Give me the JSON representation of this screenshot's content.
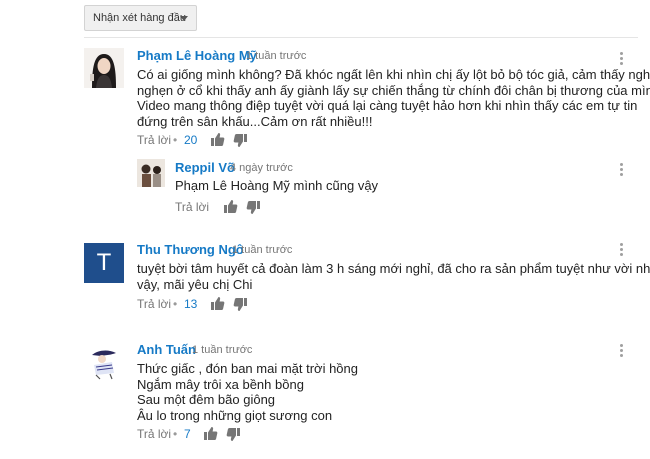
{
  "sort": {
    "label": "Nhận xét hàng đầu"
  },
  "comments": [
    {
      "author": "Phạm Lê Hoàng Mỹ",
      "time": "1 tuần trước",
      "lines": [
        "Có ai giống mình không? Đã khóc ngất lên khi nhìn chị ấy lột bỏ bộ tóc giả, cảm thấy nghèn",
        "nghẹn ở cổ khi thấy anh ấy giành lấy sự chiến thắng từ chính đôi chân bị thương của mình.",
        "Video mang thông điệp tuyệt vời quá lại càng tuyệt hảo hơn khi nhìn thấy các em tự tin",
        "đứng trên sân khấu...Cảm ơn rất nhiều!!!"
      ],
      "reply_label": "Trả lời",
      "likes": "20"
    },
    {
      "author": "Reppil Võ",
      "time": "4 ngày trước",
      "lines": [
        "Phạm Lê Hoàng Mỹ mình cũng vậy"
      ],
      "reply_label": "Trả lời"
    },
    {
      "author": "Thu Thương Ngô",
      "avatar_letter": "T",
      "avatar_color": "#1f4e8c",
      "time": "1 tuần trước",
      "lines": [
        "tuyệt bời tâm huyết cả đoàn làm 3 h sáng mới nghỉ, đã cho ra sản phẩm tuyệt như vời như",
        "vậy, mãi yêu chị Chi"
      ],
      "reply_label": "Trả lời",
      "likes": "13"
    },
    {
      "author": "Anh Tuấn",
      "time": "1 tuần trước",
      "lines": [
        "Thức giấc , đón ban mai mặt trời hồng",
        "Ngắm mây trôi xa bềnh bồng",
        "Sau một đêm bão giông",
        "Âu lo trong những giọt sương con"
      ],
      "reply_label": "Trả lời",
      "likes": "7"
    }
  ],
  "colors": {
    "link": "#167ac6",
    "meta": "#767676",
    "avatar_t": "#1f4e8c"
  },
  "icons": [
    "caret-down-icon",
    "thumbs-up-icon",
    "thumbs-down-icon",
    "more-vert-icon"
  ]
}
